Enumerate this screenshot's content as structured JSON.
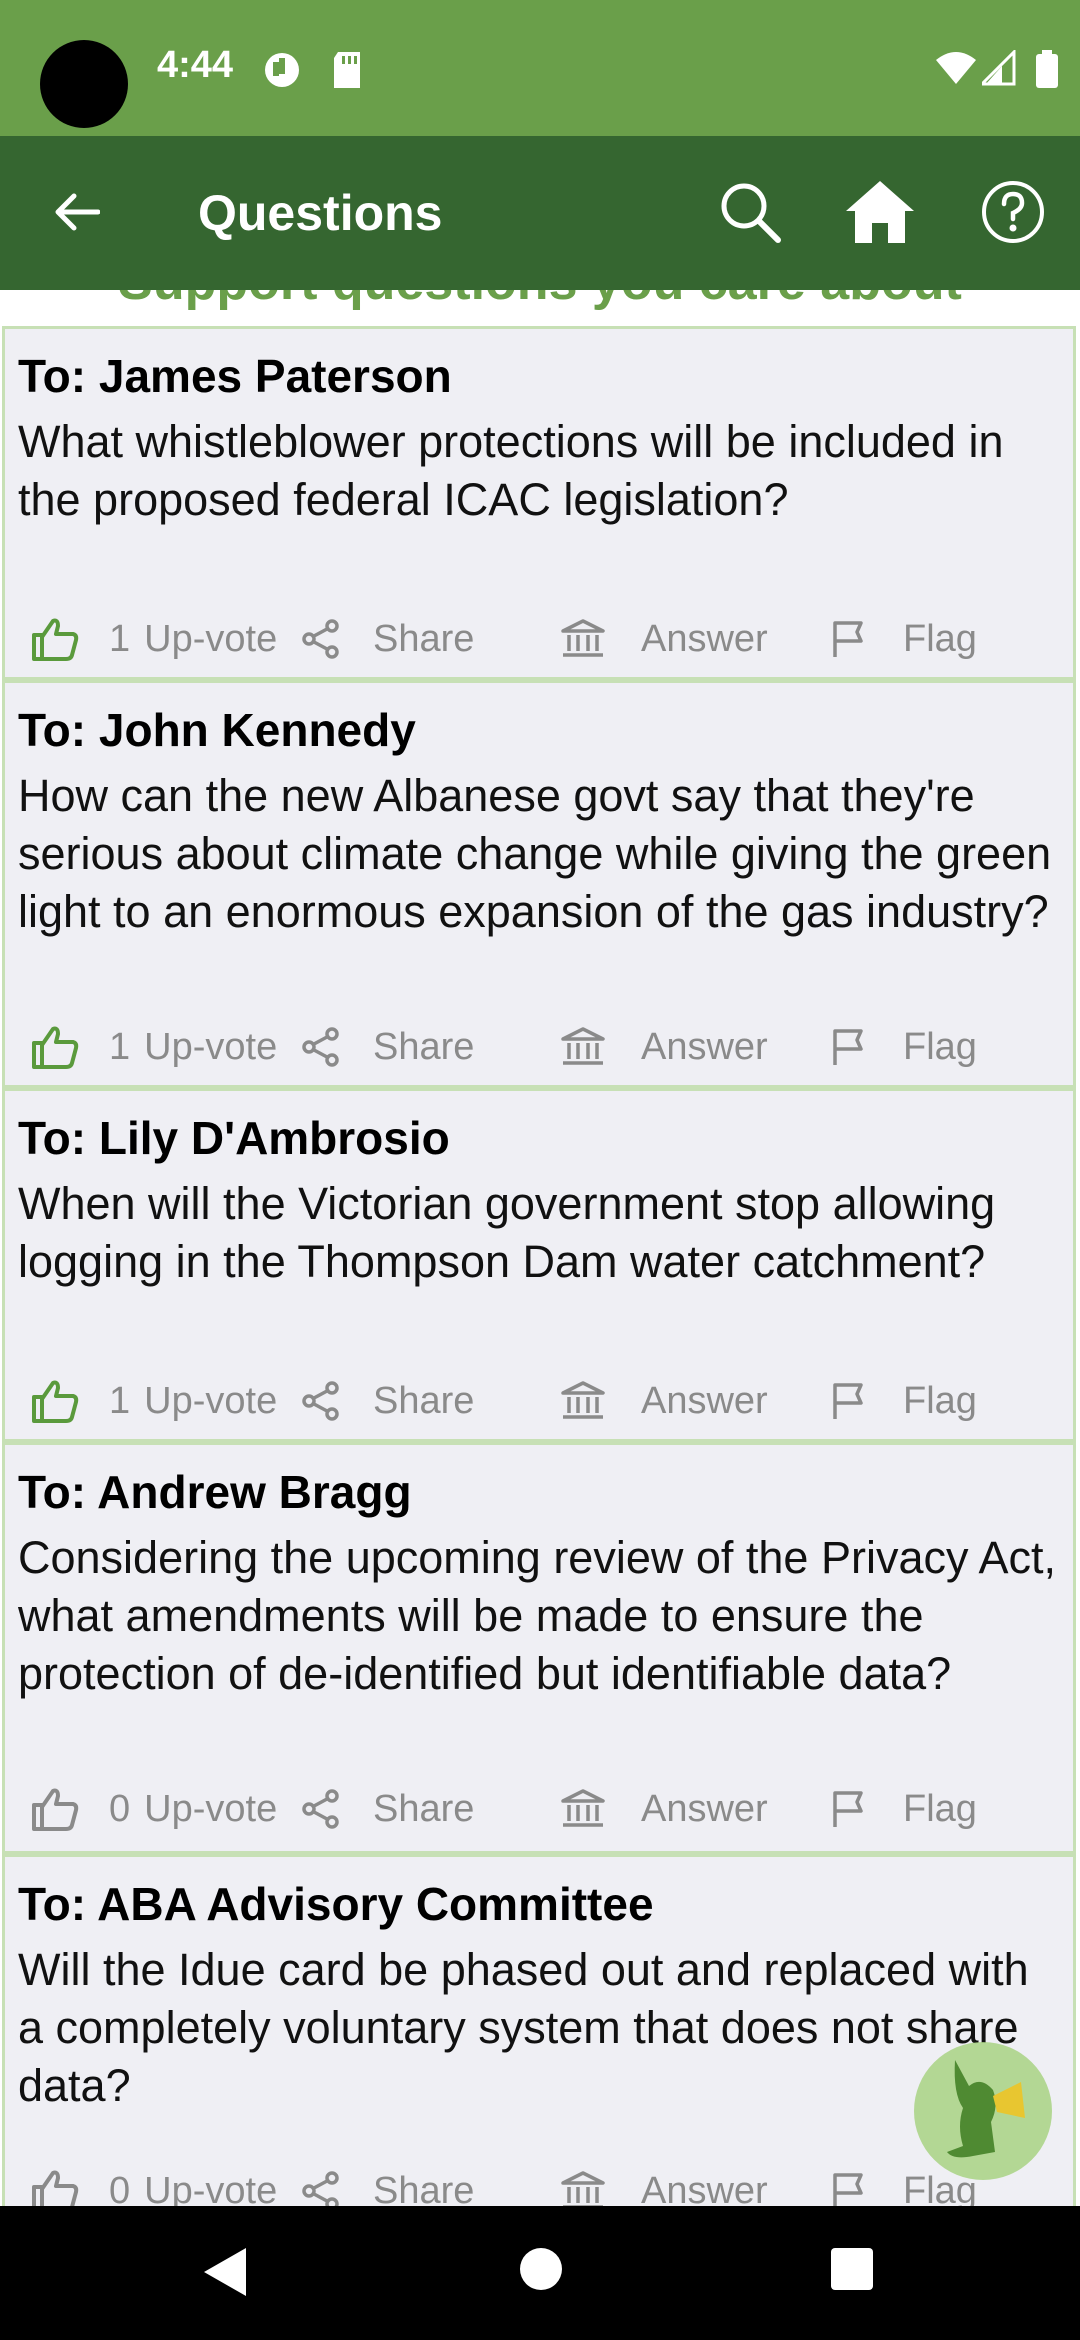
{
  "status_bar": {
    "time": "4:44"
  },
  "app_bar": {
    "title": "Questions"
  },
  "banner": "Support questions you care about",
  "questions": [
    {
      "to": "To: James Paterson",
      "text": "What whistleblower protections will be included in the proposed federal ICAC legislation?",
      "upvotes": "1",
      "upvoted": true
    },
    {
      "to": "To: John Kennedy",
      "text": "How can the new Albanese govt say that they're serious about climate change while giving the green light to an enormous expansion of the gas industry?",
      "upvotes": "1",
      "upvoted": true
    },
    {
      "to": "To: Lily D'Ambrosio",
      "text": "When will the Victorian government stop allowing logging in the Thompson Dam water catchment?",
      "upvotes": "1",
      "upvoted": true
    },
    {
      "to": "To: Andrew Bragg",
      "text": "Considering the upcoming review of the Privacy Act, what amendments will be made to ensure the protection of de-identified but identifiable data?",
      "upvotes": "0",
      "upvoted": false
    },
    {
      "to": "To: ABA Advisory Committee",
      "text": "Will the Idue card be phased out and replaced with a completely voluntary system that does not share data?",
      "upvotes": "0",
      "upvoted": false
    }
  ],
  "actions": {
    "upvote_label": "Up-vote",
    "share_label": "Share",
    "answer_label": "Answer",
    "flag_label": "Flag"
  },
  "colors": {
    "status_bar": "#6a9f4a",
    "app_bar": "#356630",
    "card_bg": "#efeff4",
    "card_border": "#c7e0b5",
    "upvoted": "#5a9a3c",
    "action_gray": "#8a8a8a"
  }
}
